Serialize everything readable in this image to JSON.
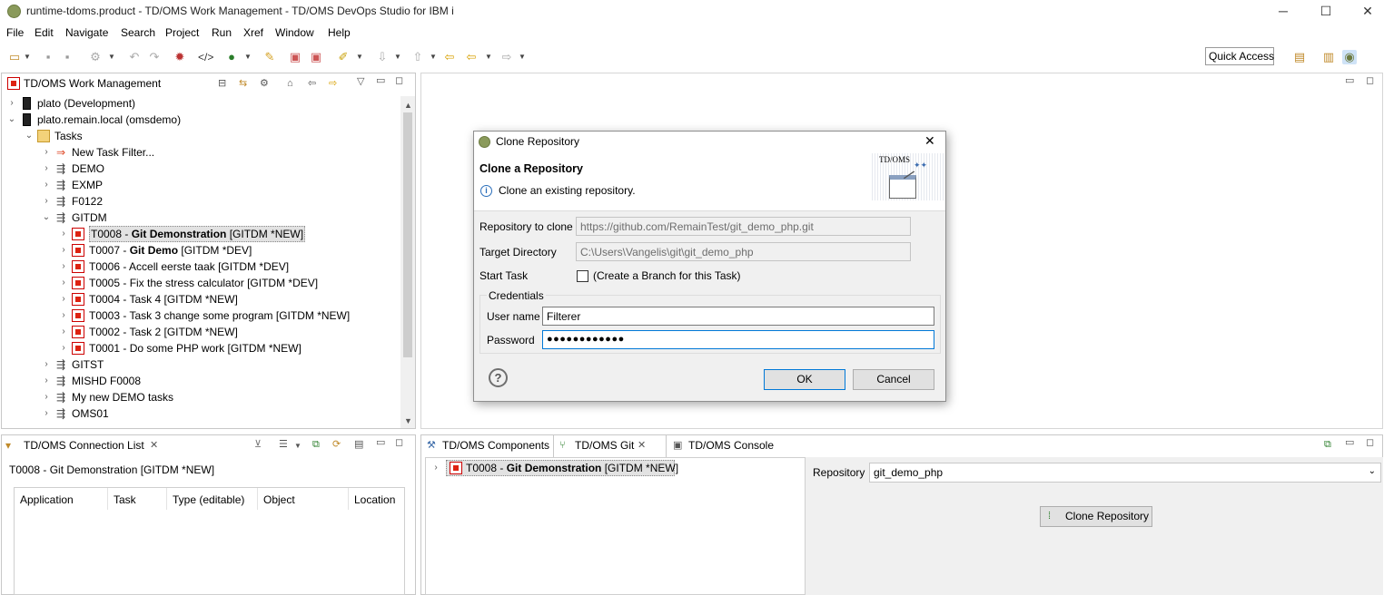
{
  "window": {
    "title": "runtime-tdoms.product - TD/OMS Work Management - TD/OMS DevOps Studio for IBM i",
    "min": "─",
    "max": "☐",
    "close": "✕"
  },
  "menu": [
    "File",
    "Edit",
    "Navigate",
    "Search",
    "Project",
    "Run",
    "Xref",
    "Window",
    "Help"
  ],
  "toolbar": {
    "quick_access": "Quick Access"
  },
  "work_mgmt": {
    "title": "TD/OMS Work Management",
    "tree": [
      {
        "label": "plato (Development)",
        "level": 0,
        "type": "server",
        "expand": "›"
      },
      {
        "label": "plato.remain.local (omsdemo)",
        "level": 0,
        "type": "server",
        "expand": "⌄"
      },
      {
        "label": "Tasks",
        "level": 1,
        "type": "folder",
        "expand": "⌄"
      },
      {
        "label": "New Task Filter...",
        "level": 2,
        "type": "filter",
        "expand": "›"
      },
      {
        "label": "DEMO",
        "level": 2,
        "type": "app",
        "expand": "›"
      },
      {
        "label": "EXMP",
        "level": 2,
        "type": "app",
        "expand": "›"
      },
      {
        "label": "F0122",
        "level": 2,
        "type": "app",
        "expand": "›"
      },
      {
        "label": "GITDM",
        "level": 2,
        "type": "app",
        "expand": "⌄"
      },
      {
        "label": "T0008 - ",
        "bold": "Git Demonstration",
        "suffix": " [GITDM *NEW]",
        "level": 3,
        "type": "task",
        "expand": "›",
        "selected": true
      },
      {
        "label": "T0007 - ",
        "bold": "Git Demo",
        "suffix": " [GITDM *DEV]",
        "level": 3,
        "type": "task",
        "expand": "›"
      },
      {
        "label": "T0006 - Accell eerste taak [GITDM *DEV]",
        "level": 3,
        "type": "task",
        "expand": "›"
      },
      {
        "label": "T0005 - Fix the stress calculator [GITDM *DEV]",
        "level": 3,
        "type": "task",
        "expand": "›"
      },
      {
        "label": "T0004 - Task 4 [GITDM *NEW]",
        "level": 3,
        "type": "task",
        "expand": "›"
      },
      {
        "label": "T0003 - Task 3 change some program [GITDM *NEW]",
        "level": 3,
        "type": "task",
        "expand": "›"
      },
      {
        "label": "T0002 - Task 2 [GITDM *NEW]",
        "level": 3,
        "type": "task",
        "expand": "›"
      },
      {
        "label": "T0001 - Do some PHP work [GITDM *NEW]",
        "level": 3,
        "type": "task",
        "expand": "›"
      },
      {
        "label": "GITST",
        "level": 2,
        "type": "app",
        "expand": "›"
      },
      {
        "label": "MISHD F0008",
        "level": 2,
        "type": "app",
        "expand": "›"
      },
      {
        "label": "My new DEMO tasks",
        "level": 2,
        "type": "app",
        "expand": "›"
      },
      {
        "label": "OMS01",
        "level": 2,
        "type": "app",
        "expand": "›"
      }
    ]
  },
  "connection_list": {
    "title": "TD/OMS Connection List",
    "context": "T0008 - Git Demonstration [GITDM *NEW]",
    "columns": [
      "Application",
      "Task",
      "Type (editable)",
      "Object",
      "Location"
    ]
  },
  "bottom_tabs": {
    "components": "TD/OMS Components",
    "git": "TD/OMS Git",
    "console": "TD/OMS Console"
  },
  "git_panel": {
    "task_prefix": "T0008 - ",
    "task_bold": "Git Demonstration",
    "task_suffix": " [GITDM *NEW]",
    "repository_label": "Repository",
    "repository_value": "git_demo_php",
    "clone_button": "Clone Repository"
  },
  "dialog": {
    "title": "Clone Repository",
    "heading": "Clone a Repository",
    "info": "Clone an existing repository.",
    "banner_text": "TD/OMS",
    "repo_label": "Repository to clone",
    "repo_value": "https://github.com/RemainTest/git_demo_php.git",
    "target_label": "Target Directory",
    "target_value": "C:\\Users\\Vangelis\\git\\git_demo_php",
    "start_label": "Start Task",
    "start_check_label": "(Create a Branch for this Task)",
    "credentials_label": "Credentials",
    "user_label": "User name",
    "user_value": "Filterer",
    "password_label": "Password",
    "password_value": "●●●●●●●●●●●●",
    "help": "?",
    "ok": "OK",
    "cancel": "Cancel"
  }
}
